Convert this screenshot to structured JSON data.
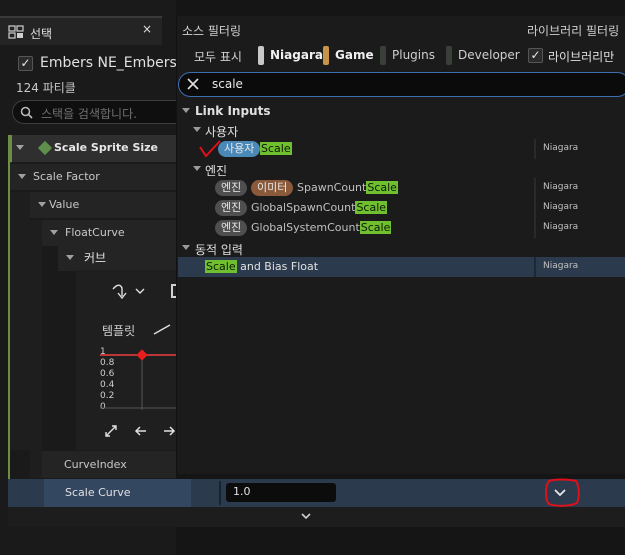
{
  "left_panel": {
    "tab_label": "선택",
    "tab_close": "×",
    "selected_name": "Embers NE_Embers_",
    "selected_checked": "✓",
    "particle_count": "124 파티클",
    "search_placeholder": "스택을 검색합니다.",
    "tree": {
      "scale_sprite_size": "Scale Sprite Size",
      "scale_factor": "Scale Factor",
      "value": "Value",
      "float_curve": "FloatCurve",
      "curve": "커브",
      "template_label": "템플릿",
      "graph_labels": [
        "1",
        "0.8",
        "0.6",
        "0.4",
        "0.2",
        "0"
      ],
      "curve_index": "CurveIndex"
    }
  },
  "scale_curve_row": {
    "label": "Scale Curve",
    "value": "1.0"
  },
  "popup": {
    "source_filter_label": "소스 필터링",
    "library_filter_label": "라이브러리 필터링",
    "chips": [
      {
        "label": "모두 표시",
        "active": false
      },
      {
        "label": "Niagara",
        "active": true,
        "color": "#c8c8c8"
      },
      {
        "label": "Game",
        "active": true,
        "color": "#c8944a"
      },
      {
        "label": "Plugins",
        "active": false,
        "color": "#3a3f3a"
      },
      {
        "label": "Developer",
        "active": false,
        "color": "#3a3f3a"
      }
    ],
    "library_only_label": "라이브러리만",
    "library_only_checked": "✓",
    "search_value": "scale",
    "results": {
      "link_inputs": "Link Inputs",
      "user_category": "사용자",
      "user_pill": "사용자",
      "user_item": "Scale",
      "engine_category": "엔진",
      "engine_pill": "엔진",
      "emitter_pill": "이미터",
      "spawn_prefix": "SpawnCount",
      "spawn_hl": "Scale",
      "global_spawn_prefix": "GlobalSpawnCount",
      "global_spawn_hl": "Scale",
      "global_system_prefix": "GlobalSystemCount",
      "global_system_hl": "Scale",
      "dynamic_category": "동적 입력",
      "dynamic_hl": "Scale",
      "dynamic_rest": " and Bias Float",
      "source": "Niagara"
    }
  },
  "colors": {
    "accent_blue": "#3c6fb0",
    "highlight_green": "#6fbf2f",
    "annotation_red": "#e0101a",
    "tree_green": "#6d8f44"
  },
  "icons": [
    "panel-tab-icon",
    "search-icon",
    "close-x-icon",
    "curve-shape-icon",
    "chevron-down-icon",
    "linear-curve-icon",
    "expand-arrows-icon",
    "arrow-left-icon",
    "arrow-right-icon"
  ]
}
